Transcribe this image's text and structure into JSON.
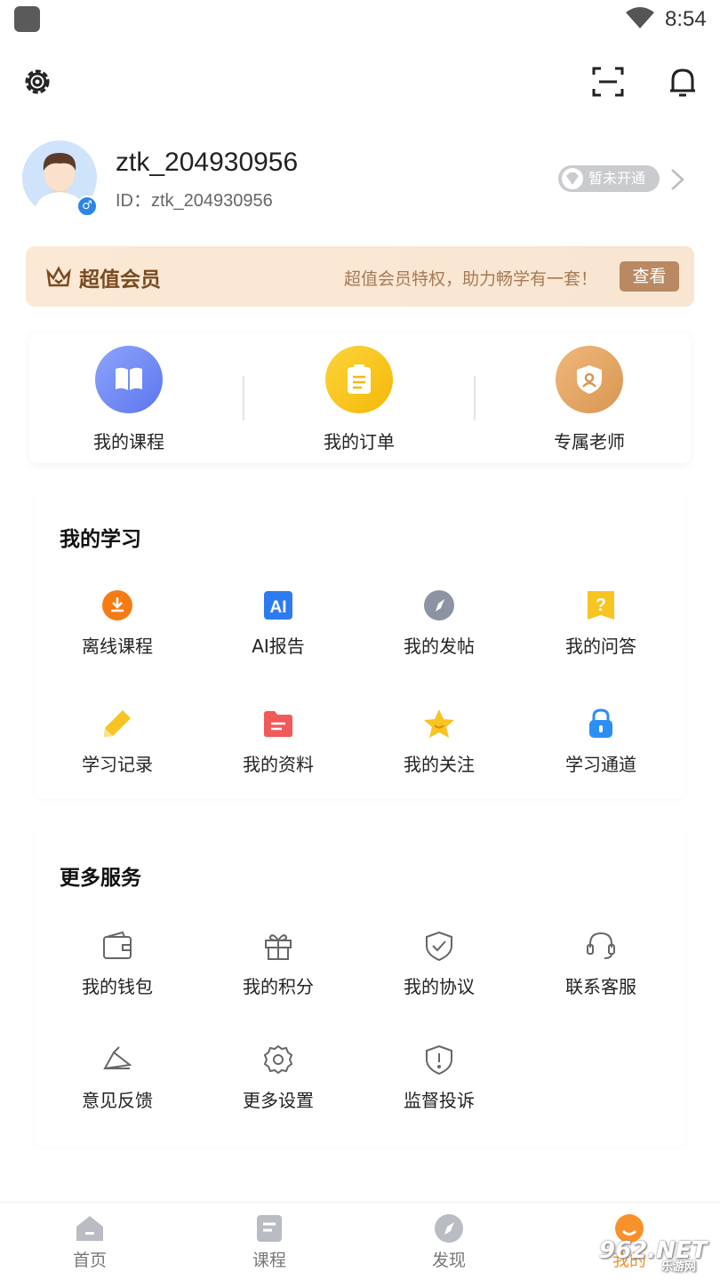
{
  "status_bar": {
    "time": "8:54"
  },
  "profile": {
    "username": "ztk_204930956",
    "user_id": "ID：ztk_204930956",
    "vip_status": "暂未开通"
  },
  "vip_banner": {
    "title": "超值会员",
    "description": "超值会员特权，助力畅学有一套！",
    "button": "查看"
  },
  "quick_actions": [
    {
      "label": "我的课程",
      "icon": "book-icon",
      "color": "#6f88f5"
    },
    {
      "label": "我的订单",
      "icon": "clipboard-icon",
      "color": "#f7c21a"
    },
    {
      "label": "专属老师",
      "icon": "teacher-shield-icon",
      "color": "#e2a365"
    }
  ],
  "my_study": {
    "title": "我的学习",
    "items": [
      {
        "label": "离线课程",
        "icon": "download-icon"
      },
      {
        "label": "AI报告",
        "icon": "ai-icon",
        "icon_text": "AI"
      },
      {
        "label": "我的发帖",
        "icon": "compass-icon"
      },
      {
        "label": "我的问答",
        "icon": "question-icon",
        "icon_text": "?"
      },
      {
        "label": "学习记录",
        "icon": "pencil-icon"
      },
      {
        "label": "我的资料",
        "icon": "folder-icon"
      },
      {
        "label": "我的关注",
        "icon": "star-icon"
      },
      {
        "label": "学习通道",
        "icon": "lock-icon"
      }
    ]
  },
  "more_services": {
    "title": "更多服务",
    "items": [
      {
        "label": "我的钱包",
        "icon": "wallet-icon"
      },
      {
        "label": "我的积分",
        "icon": "gift-icon"
      },
      {
        "label": "我的协议",
        "icon": "shield-check-icon"
      },
      {
        "label": "联系客服",
        "icon": "headset-icon"
      },
      {
        "label": "意见反馈",
        "icon": "feedback-icon"
      },
      {
        "label": "更多设置",
        "icon": "gear-icon"
      },
      {
        "label": "监督投诉",
        "icon": "shield-alert-icon"
      }
    ]
  },
  "tab_bar": [
    {
      "label": "首页",
      "icon": "home-icon"
    },
    {
      "label": "课程",
      "icon": "course-icon"
    },
    {
      "label": "发现",
      "icon": "discover-icon"
    },
    {
      "label": "我的",
      "icon": "profile-icon"
    }
  ],
  "watermark": {
    "main": "962.NET",
    "sub": "乐游网"
  }
}
